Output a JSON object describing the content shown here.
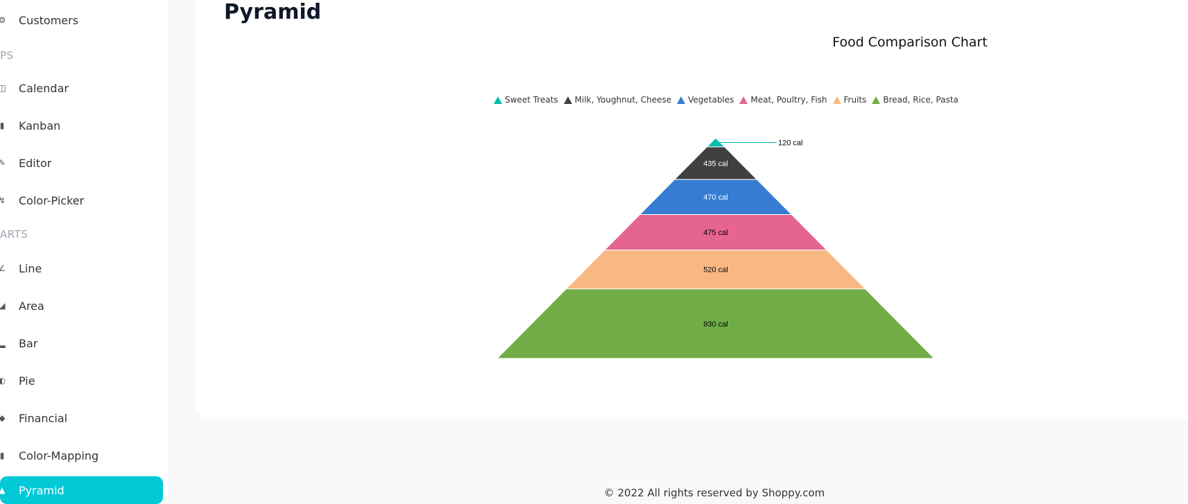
{
  "sidebar": {
    "items_top": [
      {
        "label": "Customers",
        "icon": "customers-icon"
      }
    ],
    "section_apps": "PS",
    "apps": [
      {
        "label": "Calendar",
        "icon": "calendar-icon"
      },
      {
        "label": "Kanban",
        "icon": "kanban-icon"
      },
      {
        "label": "Editor",
        "icon": "editor-icon"
      },
      {
        "label": "Color-Picker",
        "icon": "color-picker-icon"
      }
    ],
    "section_charts": "ARTS",
    "charts": [
      {
        "label": "Line",
        "icon": "line-chart-icon"
      },
      {
        "label": "Area",
        "icon": "area-chart-icon"
      },
      {
        "label": "Bar",
        "icon": "bar-chart-icon"
      },
      {
        "label": "Pie",
        "icon": "pie-chart-icon"
      },
      {
        "label": "Financial",
        "icon": "financial-icon"
      },
      {
        "label": "Color-Mapping",
        "icon": "color-mapping-icon"
      },
      {
        "label": "Pyramid",
        "icon": "pyramid-icon",
        "active": true
      }
    ],
    "active_color": "#03c9d7"
  },
  "page": {
    "title": "Pyramid"
  },
  "chart_data": {
    "type": "pyramid",
    "title": "Food Comparison Chart",
    "legend_position": "top",
    "series": [
      {
        "name": "Sweet Treats",
        "value": 120,
        "label": "120 cal",
        "color": "#00bdae"
      },
      {
        "name": "Milk, Youghnut, Cheese",
        "value": 435,
        "label": "435 cal",
        "color": "#404041"
      },
      {
        "name": "Vegetables",
        "value": 470,
        "label": "470 cal",
        "color": "#357cd2"
      },
      {
        "name": "Meat, Poultry, Fish",
        "value": 475,
        "label": "475 cal",
        "color": "#e56590"
      },
      {
        "name": "Fruits",
        "value": 520,
        "label": "520 cal",
        "color": "#f8b883"
      },
      {
        "name": "Bread, Rice, Pasta",
        "value": 930,
        "label": "930 cal",
        "color": "#70ad47"
      }
    ]
  },
  "footer": {
    "text": "© 2022 All rights reserved by Shoppy.com"
  }
}
